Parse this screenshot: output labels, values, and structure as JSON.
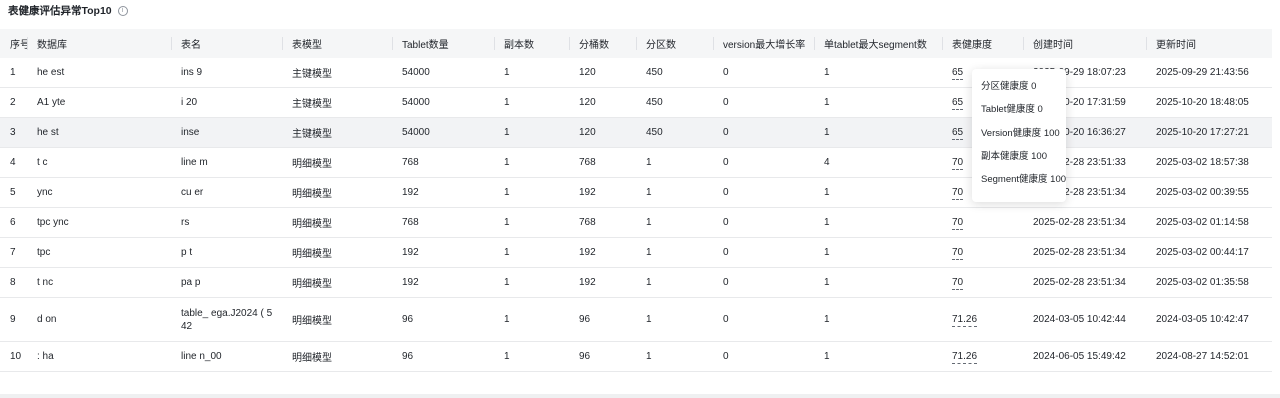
{
  "section": {
    "title": "表健康评估异常Top10",
    "info_icon": "ⓘ"
  },
  "table": {
    "columns": [
      "序号",
      "数据库",
      "表名",
      "表模型",
      "Tablet数量",
      "副本数",
      "分桶数",
      "分区数",
      "version最大增长率",
      "单tablet最大segment数",
      "表健康度",
      "创建时间",
      "更新时间"
    ],
    "rows": [
      {
        "idx": "1",
        "db": "he      est",
        "tbl": "ins          9",
        "model": "主键模型",
        "tablets": "54000",
        "replicas": "1",
        "buckets": "120",
        "partitions": "450",
        "version_growth": "0",
        "max_segments": "1",
        "health": "65",
        "created": "2025-09-29 18:07:23",
        "updated": "2025-09-29 21:43:56"
      },
      {
        "idx": "2",
        "db": "A1              yte",
        "tbl": "i     20",
        "model": "主键模型",
        "tablets": "54000",
        "replicas": "1",
        "buckets": "120",
        "partitions": "450",
        "version_growth": "0",
        "max_segments": "1",
        "health": "65",
        "created": "2025-10-20 17:31:59",
        "updated": "2025-10-20 18:48:05"
      },
      {
        "idx": "3",
        "db": "he       st",
        "tbl": "inse",
        "model": "主键模型",
        "tablets": "54000",
        "replicas": "1",
        "buckets": "120",
        "partitions": "450",
        "version_growth": "0",
        "max_segments": "1",
        "health": "65",
        "created": "2025-10-20 16:36:27",
        "updated": "2025-10-20 17:27:21"
      },
      {
        "idx": "4",
        "db": "t        c",
        "tbl": "line    m",
        "model": "明细模型",
        "tablets": "768",
        "replicas": "1",
        "buckets": "768",
        "partitions": "1",
        "version_growth": "0",
        "max_segments": "4",
        "health": "70",
        "created": "2025-02-28 23:51:33",
        "updated": "2025-03-02 18:57:38"
      },
      {
        "idx": "5",
        "db": "         ync",
        "tbl": "cu        er",
        "model": "明细模型",
        "tablets": "192",
        "replicas": "1",
        "buckets": "192",
        "partitions": "1",
        "version_growth": "0",
        "max_segments": "1",
        "health": "70",
        "created": "2025-02-28 23:51:34",
        "updated": "2025-03-02 00:39:55"
      },
      {
        "idx": "6",
        "db": "tpc      ync",
        "tbl": "      rs",
        "model": "明细模型",
        "tablets": "768",
        "replicas": "1",
        "buckets": "768",
        "partitions": "1",
        "version_growth": "0",
        "max_segments": "1",
        "health": "70",
        "created": "2025-02-28 23:51:34",
        "updated": "2025-03-02 01:14:58"
      },
      {
        "idx": "7",
        "db": "tpc",
        "tbl": "p   t",
        "model": "明细模型",
        "tablets": "192",
        "replicas": "1",
        "buckets": "192",
        "partitions": "1",
        "version_growth": "0",
        "max_segments": "1",
        "health": "70",
        "created": "2025-02-28 23:51:34",
        "updated": "2025-03-02 00:44:17"
      },
      {
        "idx": "8",
        "db": "t         nc",
        "tbl": "pa       p",
        "model": "明细模型",
        "tablets": "192",
        "replicas": "1",
        "buckets": "192",
        "partitions": "1",
        "version_growth": "0",
        "max_segments": "1",
        "health": "70",
        "created": "2025-02-28 23:51:34",
        "updated": "2025-03-02 01:35:58"
      },
      {
        "idx": "9",
        "db": "d          on",
        "tbl": "table_        ega.J2024 (    5     42",
        "model": "明细模型",
        "tablets": "96",
        "replicas": "1",
        "buckets": "96",
        "partitions": "1",
        "version_growth": "0",
        "max_segments": "1",
        "health": "71.26",
        "created": "2024-03-05 10:42:44",
        "updated": "2024-03-05 10:42:47"
      },
      {
        "idx": "10",
        "db": ":       ha",
        "tbl": "line    n_00",
        "model": "明细模型",
        "tablets": "96",
        "replicas": "1",
        "buckets": "96",
        "partitions": "1",
        "version_growth": "0",
        "max_segments": "1",
        "health": "71.26",
        "created": "2024-06-05 15:49:42",
        "updated": "2024-08-27 14:52:01"
      }
    ]
  },
  "tooltip": {
    "items": [
      "分区健康度 0",
      "Tablet健康度 0",
      "Version健康度 100",
      "副本健康度 100",
      "Segment健康度 100"
    ]
  }
}
